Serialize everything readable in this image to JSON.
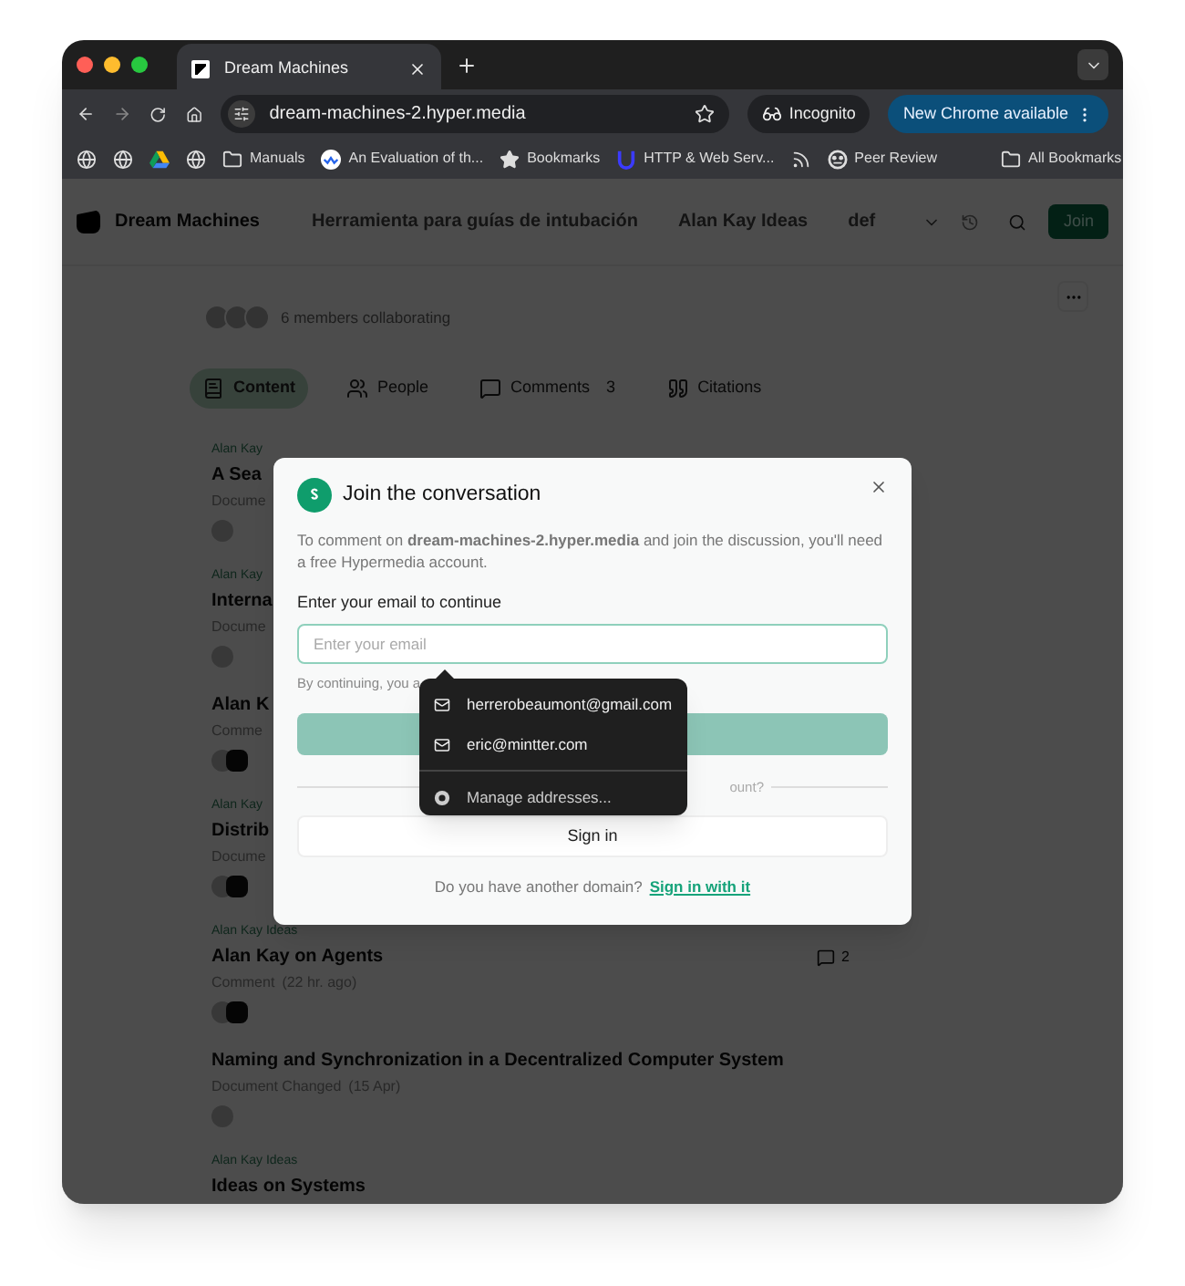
{
  "browser": {
    "tabs": [
      {
        "title": "Dream Machines",
        "selected": true
      }
    ],
    "url": "dream-machines-2.hyper.media",
    "incognito": "Incognito",
    "update": "New Chrome available",
    "bookmarks": [
      {
        "kind": "globe"
      },
      {
        "kind": "globe"
      },
      {
        "kind": "drive"
      },
      {
        "kind": "globe"
      },
      {
        "kind": "folder",
        "label": "Manuals"
      },
      {
        "kind": "site",
        "label": "An Evaluation of th..."
      },
      {
        "kind": "star",
        "label": "Bookmarks"
      },
      {
        "kind": "u",
        "label": "HTTP & Web Serv..."
      },
      {
        "kind": "rss"
      },
      {
        "kind": "peer",
        "label": "Peer Review"
      }
    ],
    "all_bookmarks": "All Bookmarks"
  },
  "site": {
    "name": "Dream Machines",
    "nav": [
      "Herramienta para guías de intubación",
      "Alan Kay Ideas",
      "def"
    ],
    "join": "Join",
    "members": "6 members collaborating",
    "tabs": [
      {
        "label": "Content",
        "selected": true
      },
      {
        "label": "People",
        "selected": false
      },
      {
        "label": "Comments",
        "count": "3",
        "selected": false
      },
      {
        "label": "Citations",
        "selected": false
      }
    ],
    "feed": [
      {
        "space": "Alan Kay",
        "title": "A Sea",
        "meta": "Docume"
      },
      {
        "space": "Alan Kay",
        "title": "Interna",
        "meta": "Docume"
      },
      {
        "title": "Alan K",
        "meta": "Comme"
      },
      {
        "space": "Alan Kay",
        "title": "Distrib",
        "meta": "Docume"
      },
      {
        "space": "Alan Kay Ideas",
        "title": "Alan Kay on Agents",
        "meta": "Comment",
        "time": "(22 hr. ago)",
        "comments": "2"
      },
      {
        "title": "Naming and Synchronization in a Decentralized Computer System",
        "meta": "Document Changed",
        "time": "(15 Apr)"
      },
      {
        "space": "Alan Kay Ideas",
        "title": "Ideas on Systems"
      }
    ]
  },
  "dialog": {
    "title": "Join the conversation",
    "intro": "To comment on **dream-machines-2.hyper.media** and join the discussion, you'll need a free Hypermedia account.",
    "label": "Enter your email to continue",
    "placeholder": "Enter your email",
    "terms": "By continuing, you a",
    "divider": "ount?",
    "sign_in": "Sign in",
    "other": "Do you have another domain?",
    "other_link": "Sign in with it"
  },
  "autofill": {
    "suggestions": [
      "herrerobeaumont@gmail.com",
      "eric@mintter.com"
    ],
    "manage": "Manage addresses..."
  }
}
